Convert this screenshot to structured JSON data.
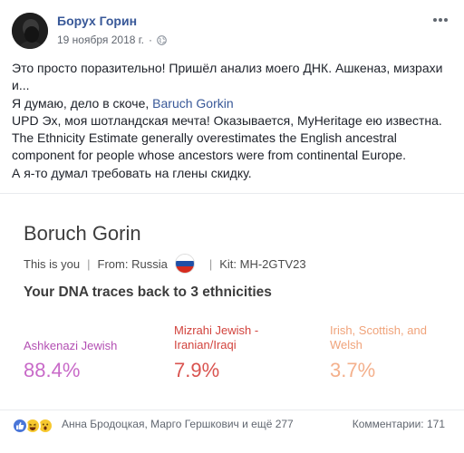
{
  "post": {
    "author": "Борух Горин",
    "date": "19 ноября 2018 г.",
    "separator": "·",
    "more_icon": "ellipsis-icon",
    "privacy_icon": "globe-icon",
    "lines": [
      {
        "text": "Это просто поразительно! Пришёл анализ моего ДНК. Ашкеназ, мизрахи и..."
      },
      {
        "prefix": "Я думаю, дело в скоче, ",
        "link": "Baruch Gorkin"
      },
      {
        "text": "UPD Эх, моя шотландская мечта! Оказывается, MyHeritage ею известна. The Ethnicity Estimate generally overestimates the English ancestral component for people whose ancestors were from continental Europe."
      },
      {
        "text": "А я-то думал требовать на глены скидку."
      }
    ]
  },
  "dna_card": {
    "name": "Boruch Gorin",
    "this_is_you": "This is you",
    "from": "From: Russia",
    "kit": "Kit: MH-2GTV23",
    "separator": "|",
    "flag_colors": [
      "#ffffff",
      "#1f4fa6",
      "#d52b1e"
    ],
    "traces": "Your DNA traces back to 3 ethnicities",
    "ethnicities": [
      {
        "label": "Ashkenazi Jewish",
        "value": "88.4%",
        "color": "#c86ac8"
      },
      {
        "label": "Mizrahi Jewish - Iranian/Iraqi",
        "value": "7.9%",
        "color": "#d9534f"
      },
      {
        "label": "Irish, Scottish, and Welsh",
        "value": "3.7%",
        "color": "#f4b08c"
      }
    ]
  },
  "footer": {
    "reactions": [
      "like-icon",
      "haha-icon",
      "wow-icon"
    ],
    "names": "Анна Бродоцкая, Марго Гершкович и ещё 277",
    "comments": "Комментарии: 171"
  }
}
